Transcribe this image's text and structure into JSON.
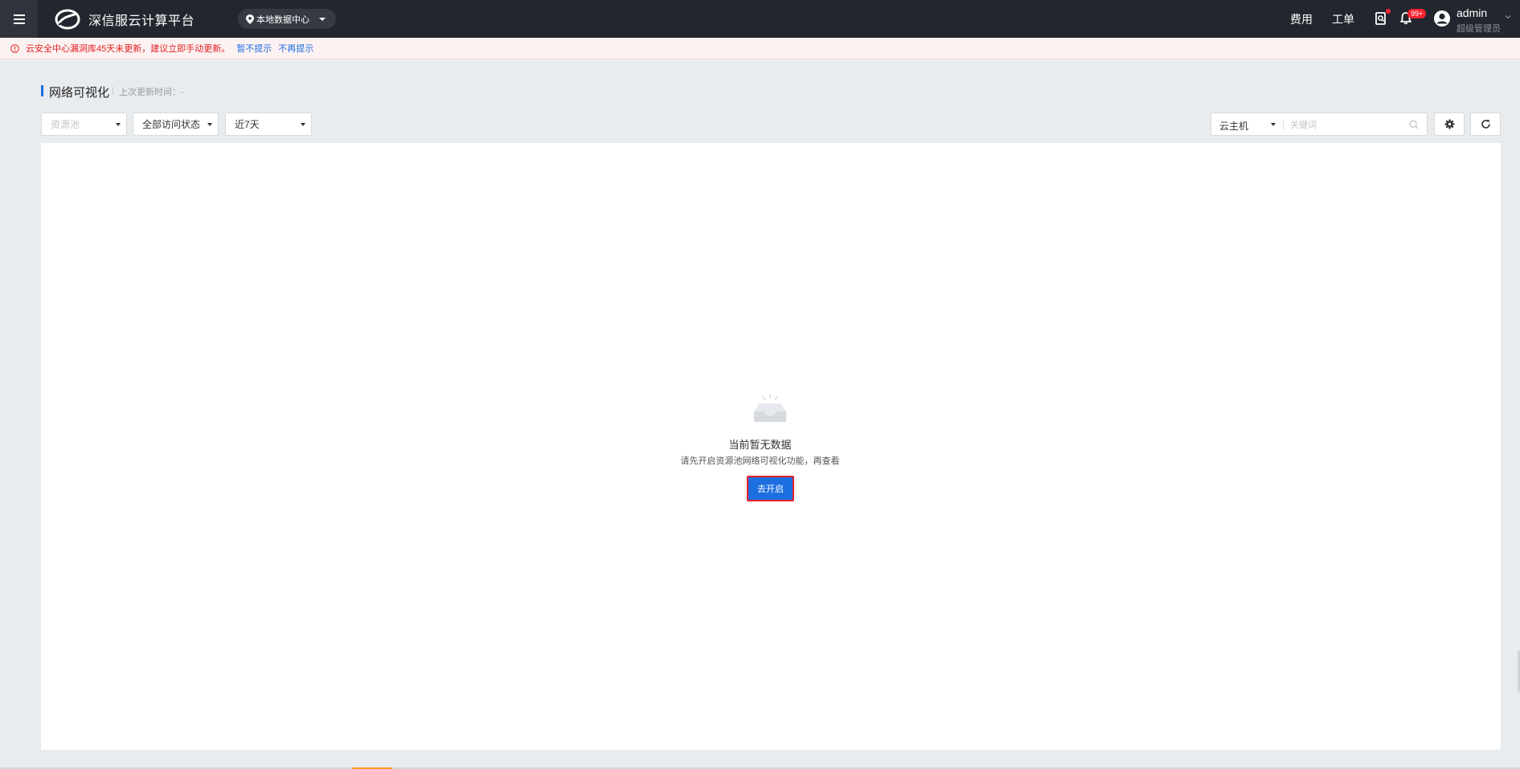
{
  "topbar": {
    "brand_name": "深信服云计算平台",
    "datacenter": "本地数据中心",
    "cost_label": "费用",
    "ticket_label": "工单",
    "notification_badge": "99+",
    "user_name": "admin",
    "user_role": "超级管理员"
  },
  "alert": {
    "message": "云安全中心漏洞库45天未更新，建议立即手动更新。",
    "snooze_label": "暂不提示",
    "dismiss_label": "不再提示"
  },
  "page": {
    "title": "网络可视化",
    "last_update_label": "上次更新时间：-"
  },
  "filters": {
    "resource_pool_placeholder": "资源池",
    "access_status": "全部访问状态",
    "time_range": "近7天",
    "search_type": "云主机",
    "search_placeholder": "关键词"
  },
  "empty_state": {
    "title": "当前暂无数据",
    "description": "请先开启资源池网络可视化功能，再查看",
    "button_label": "去开启"
  },
  "colors": {
    "topbar_bg": "#22262e",
    "accent_blue": "#1d6fe0",
    "alert_red": "#e02020",
    "badge_red": "#f5222d"
  }
}
